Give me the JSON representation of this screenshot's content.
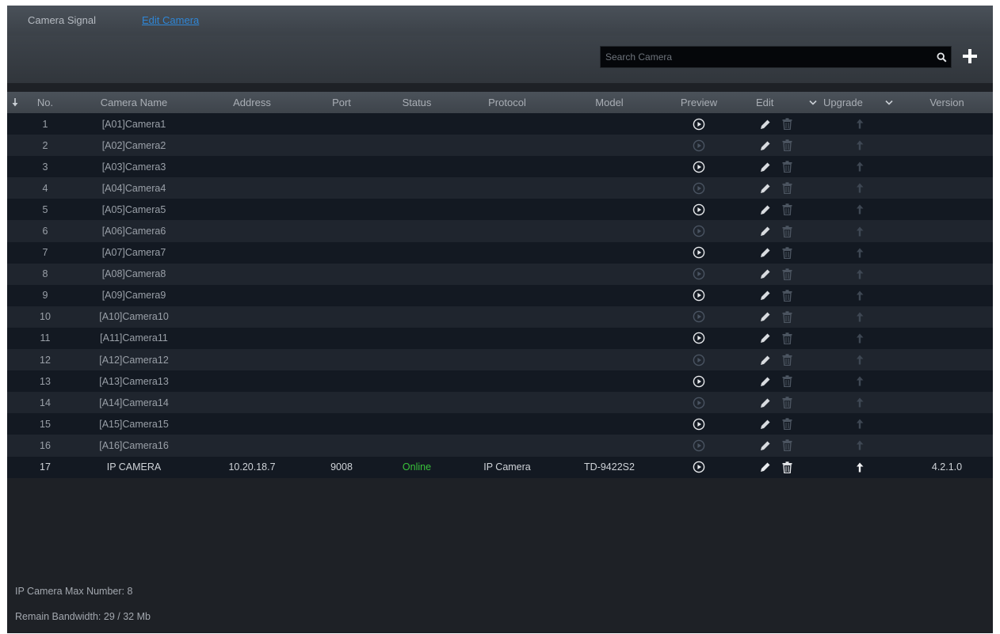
{
  "tabs": [
    {
      "label": "Camera Signal",
      "active": false
    },
    {
      "label": "Edit Camera",
      "active": true
    }
  ],
  "search": {
    "placeholder": "Search Camera"
  },
  "icons": {
    "search": "search-icon",
    "add": "plus-icon",
    "sort": "sort-down-arrow-icon",
    "preview": "play-circle-icon",
    "edit": "pencil-icon",
    "delete": "trash-icon",
    "upgrade": "upload-arrow-icon",
    "dropdown": "chevron-down-icon"
  },
  "colors": {
    "online": "#39c23b",
    "active_tab": "#2f86d6"
  },
  "table": {
    "columns": {
      "no": "No.",
      "name": "Camera Name",
      "address": "Address",
      "port": "Port",
      "status": "Status",
      "protocol": "Protocol",
      "model": "Model",
      "preview": "Preview",
      "edit": "Edit",
      "upgrade": "Upgrade",
      "version": "Version"
    },
    "rows": [
      {
        "no": "1",
        "name": "[A01]Camera1",
        "address": "",
        "port": "",
        "status": "",
        "protocol": "",
        "model": "",
        "version": ""
      },
      {
        "no": "2",
        "name": "[A02]Camera2",
        "address": "",
        "port": "",
        "status": "",
        "protocol": "",
        "model": "",
        "version": ""
      },
      {
        "no": "3",
        "name": "[A03]Camera3",
        "address": "",
        "port": "",
        "status": "",
        "protocol": "",
        "model": "",
        "version": ""
      },
      {
        "no": "4",
        "name": "[A04]Camera4",
        "address": "",
        "port": "",
        "status": "",
        "protocol": "",
        "model": "",
        "version": ""
      },
      {
        "no": "5",
        "name": "[A05]Camera5",
        "address": "",
        "port": "",
        "status": "",
        "protocol": "",
        "model": "",
        "version": ""
      },
      {
        "no": "6",
        "name": "[A06]Camera6",
        "address": "",
        "port": "",
        "status": "",
        "protocol": "",
        "model": "",
        "version": ""
      },
      {
        "no": "7",
        "name": "[A07]Camera7",
        "address": "",
        "port": "",
        "status": "",
        "protocol": "",
        "model": "",
        "version": ""
      },
      {
        "no": "8",
        "name": "[A08]Camera8",
        "address": "",
        "port": "",
        "status": "",
        "protocol": "",
        "model": "",
        "version": ""
      },
      {
        "no": "9",
        "name": "[A09]Camera9",
        "address": "",
        "port": "",
        "status": "",
        "protocol": "",
        "model": "",
        "version": ""
      },
      {
        "no": "10",
        "name": "[A10]Camera10",
        "address": "",
        "port": "",
        "status": "",
        "protocol": "",
        "model": "",
        "version": ""
      },
      {
        "no": "11",
        "name": "[A11]Camera11",
        "address": "",
        "port": "",
        "status": "",
        "protocol": "",
        "model": "",
        "version": ""
      },
      {
        "no": "12",
        "name": "[A12]Camera12",
        "address": "",
        "port": "",
        "status": "",
        "protocol": "",
        "model": "",
        "version": ""
      },
      {
        "no": "13",
        "name": "[A13]Camera13",
        "address": "",
        "port": "",
        "status": "",
        "protocol": "",
        "model": "",
        "version": ""
      },
      {
        "no": "14",
        "name": "[A14]Camera14",
        "address": "",
        "port": "",
        "status": "",
        "protocol": "",
        "model": "",
        "version": ""
      },
      {
        "no": "15",
        "name": "[A15]Camera15",
        "address": "",
        "port": "",
        "status": "",
        "protocol": "",
        "model": "",
        "version": ""
      },
      {
        "no": "16",
        "name": "[A16]Camera16",
        "address": "",
        "port": "",
        "status": "",
        "protocol": "",
        "model": "",
        "version": ""
      },
      {
        "no": "17",
        "name": "IP CAMERA",
        "address": "10.20.18.7",
        "port": "9008",
        "status": "Online",
        "protocol": "IP Camera",
        "model": "TD-9422S2",
        "version": "4.2.1.0"
      }
    ]
  },
  "footer": {
    "max_number": "IP Camera Max Number: 8",
    "bandwidth": "Remain Bandwidth: 29 / 32 Mb"
  }
}
